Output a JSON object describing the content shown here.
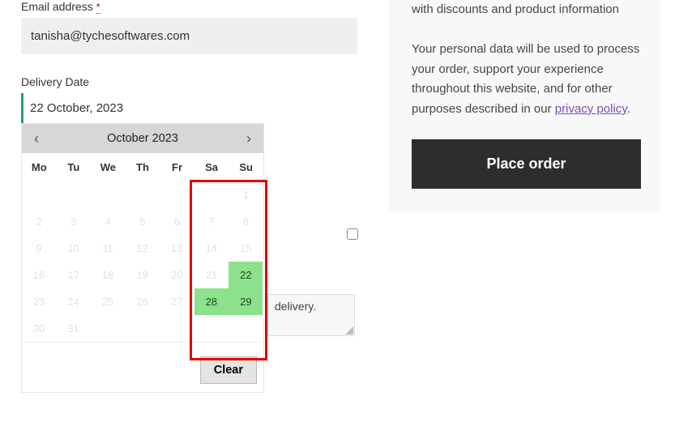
{
  "form": {
    "email": {
      "label": "Email address",
      "required_mark": "*",
      "value": "tanisha@tychesoftwares.com"
    },
    "delivery": {
      "label": "Delivery Date",
      "value": "22 October, 2023",
      "hint": "delivery."
    }
  },
  "calendar": {
    "title": "October 2023",
    "dow": [
      "Mo",
      "Tu",
      "We",
      "Th",
      "Fr",
      "Sa",
      "Su"
    ],
    "clear_label": "Clear",
    "weeks": [
      [
        null,
        null,
        null,
        null,
        null,
        null,
        {
          "d": 1,
          "s": "disabled"
        }
      ],
      [
        {
          "d": 2,
          "s": "disabled"
        },
        {
          "d": 3,
          "s": "disabled"
        },
        {
          "d": 4,
          "s": "disabled"
        },
        {
          "d": 5,
          "s": "disabled"
        },
        {
          "d": 6,
          "s": "disabled"
        },
        {
          "d": 7,
          "s": "disabled"
        },
        {
          "d": 8,
          "s": "disabled"
        }
      ],
      [
        {
          "d": 9,
          "s": "disabled"
        },
        {
          "d": 10,
          "s": "disabled"
        },
        {
          "d": 11,
          "s": "disabled"
        },
        {
          "d": 12,
          "s": "disabled"
        },
        {
          "d": 13,
          "s": "disabled"
        },
        {
          "d": 14,
          "s": "disabled"
        },
        {
          "d": 15,
          "s": "disabled"
        }
      ],
      [
        {
          "d": 16,
          "s": "disabled"
        },
        {
          "d": 17,
          "s": "disabled"
        },
        {
          "d": 18,
          "s": "disabled"
        },
        {
          "d": 19,
          "s": "disabled"
        },
        {
          "d": 20,
          "s": "disabled"
        },
        {
          "d": 21,
          "s": "disabled"
        },
        {
          "d": 22,
          "s": "avail"
        }
      ],
      [
        {
          "d": 23,
          "s": "disabled"
        },
        {
          "d": 24,
          "s": "disabled"
        },
        {
          "d": 25,
          "s": "disabled"
        },
        {
          "d": 26,
          "s": "disabled"
        },
        {
          "d": 27,
          "s": "disabled"
        },
        {
          "d": 28,
          "s": "avail"
        },
        {
          "d": 29,
          "s": "avail"
        }
      ],
      [
        {
          "d": 30,
          "s": "disabled"
        },
        {
          "d": 31,
          "s": "disabled"
        },
        null,
        null,
        null,
        null,
        null
      ]
    ]
  },
  "sidebar": {
    "line1": "with discounts and product information",
    "line2_prefix": "Your personal data will be used to process your order, support your experience throughout this website, and for other purposes described in our ",
    "policy_text": "privacy policy",
    "line2_suffix": ".",
    "place_order": "Place order"
  }
}
